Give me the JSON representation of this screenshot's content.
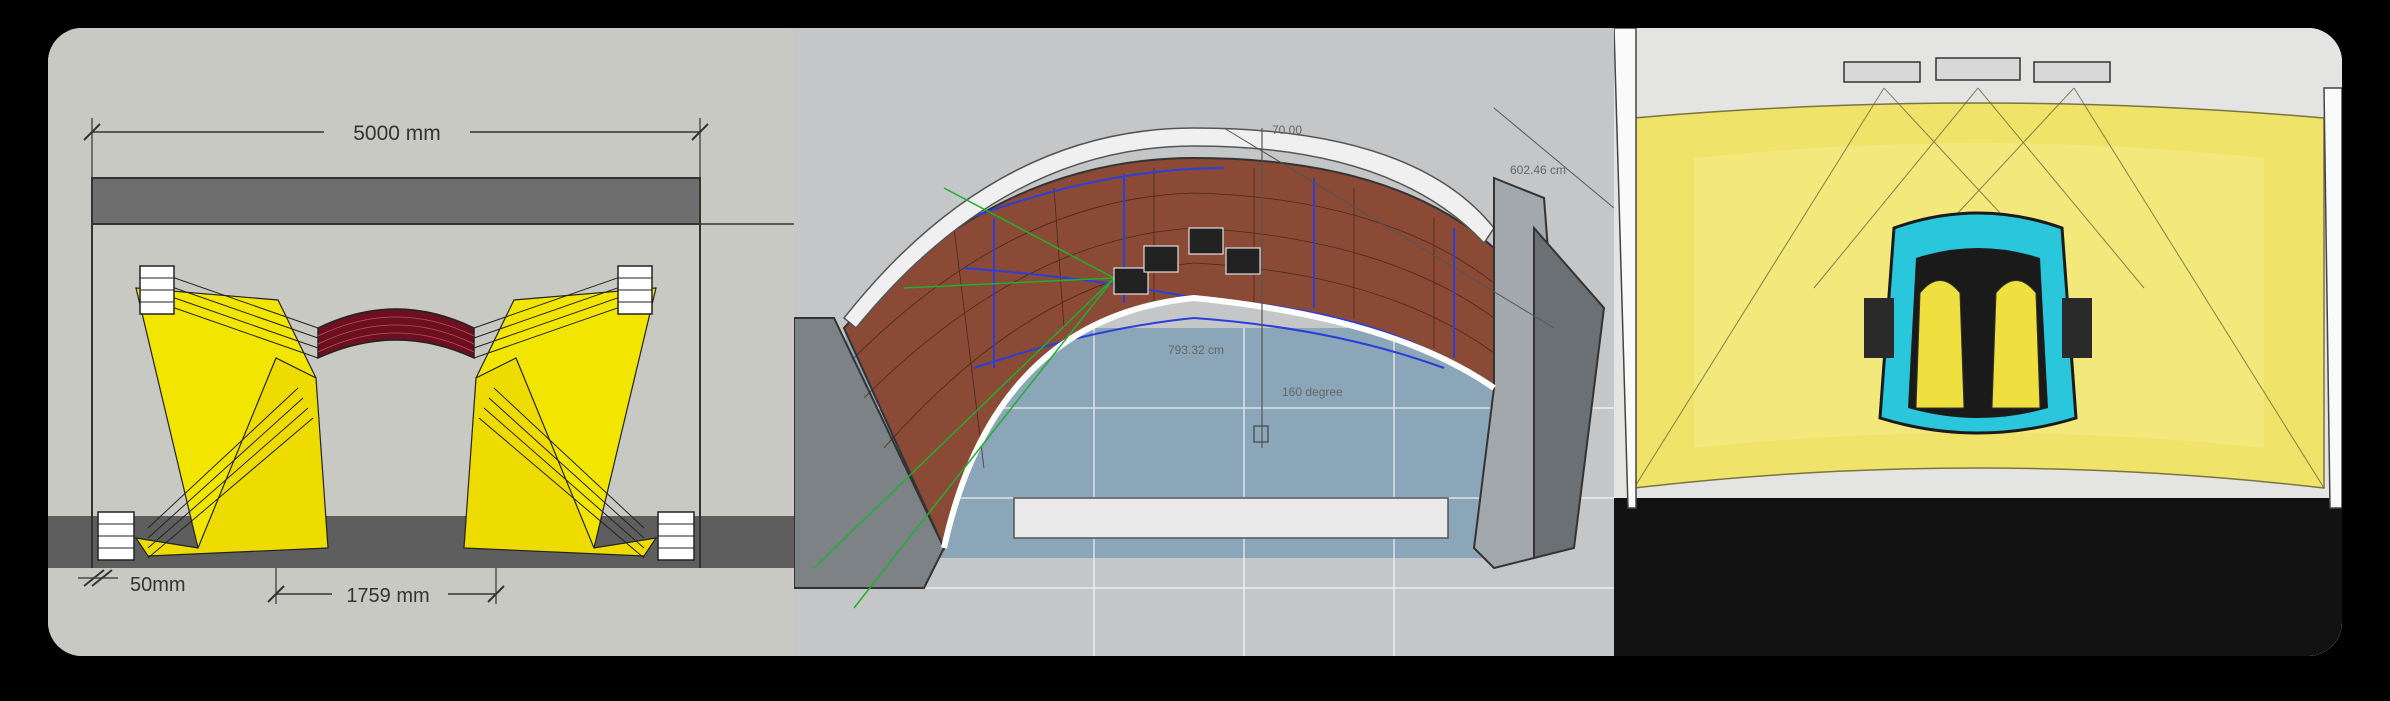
{
  "panels": {
    "left": {
      "width_label": "5000 mm",
      "offset_label": "50mm",
      "gap_label": "1759 mm"
    },
    "middle": {
      "height_label": "70.00",
      "depth_label": "602.46 cm",
      "width_label": "793.32 cm",
      "angle_label": "160 degree"
    },
    "right": {}
  },
  "colors": {
    "projection_yellow": "#f2e600",
    "screen_brown": "#8a4a35",
    "cabin_cyan": "#29c6dc",
    "floor_blue": "#8aa6b8",
    "background_gray": "#c9c9c4"
  }
}
